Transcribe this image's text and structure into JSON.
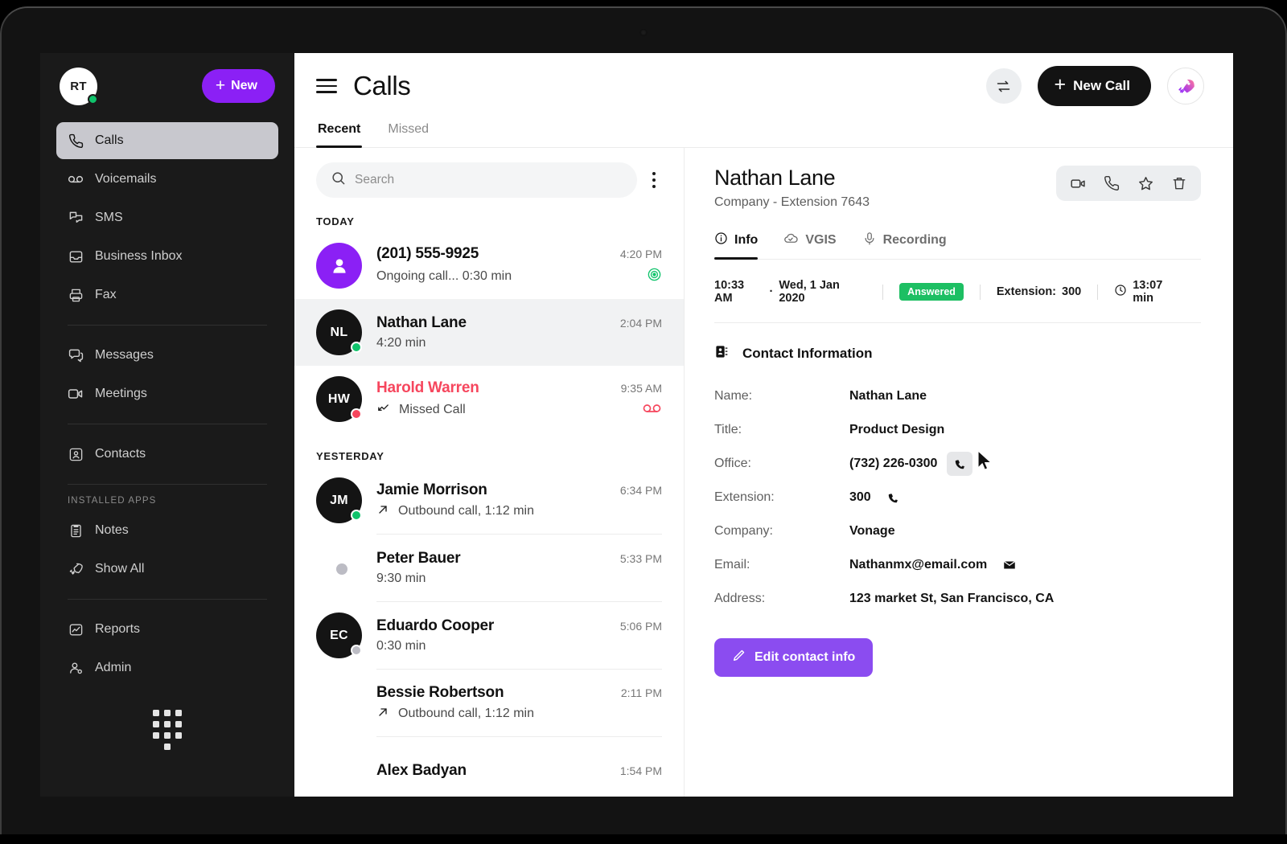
{
  "sidebar": {
    "avatar_initials": "RT",
    "new_button": "New",
    "section_label": "INSTALLED APPS",
    "items": [
      {
        "label": "Calls",
        "icon": "phone-icon"
      },
      {
        "label": "Voicemails",
        "icon": "voicemail-icon"
      },
      {
        "label": "SMS",
        "icon": "sms-icon"
      },
      {
        "label": "Business Inbox",
        "icon": "inbox-icon"
      },
      {
        "label": "Fax",
        "icon": "fax-icon"
      },
      {
        "label": "Messages",
        "icon": "messages-icon"
      },
      {
        "label": "Meetings",
        "icon": "video-icon"
      },
      {
        "label": "Contacts",
        "icon": "contacts-icon"
      },
      {
        "label": "Notes",
        "icon": "notes-icon"
      },
      {
        "label": "Show All",
        "icon": "rocket-icon"
      },
      {
        "label": "Reports",
        "icon": "reports-icon"
      },
      {
        "label": "Admin",
        "icon": "admin-icon"
      }
    ]
  },
  "header": {
    "title": "Calls",
    "new_call": "New Call",
    "tabs": [
      {
        "label": "Recent"
      },
      {
        "label": "Missed"
      }
    ]
  },
  "search": {
    "placeholder": "Search",
    "value": ""
  },
  "call_list": {
    "groups": [
      {
        "day": "TODAY",
        "calls": [
          {
            "name": "(201) 555-9925",
            "initials": "",
            "time": "4:20 PM",
            "subtitle": "Ongoing call... 0:30 min",
            "status": "ongoing"
          },
          {
            "name": "Nathan Lane",
            "initials": "NL",
            "time": "2:04 PM",
            "subtitle": "4:20 min",
            "status": "answered"
          },
          {
            "name": "Harold Warren",
            "initials": "HW",
            "time": "9:35 AM",
            "subtitle": "Missed Call",
            "status": "missed"
          }
        ]
      },
      {
        "day": "YESTERDAY",
        "calls": [
          {
            "name": "Jamie Morrison",
            "initials": "JM",
            "time": "6:34 PM",
            "subtitle": "Outbound call, 1:12 min",
            "status": "outbound"
          },
          {
            "name": "Peter Bauer",
            "initials": "",
            "time": "5:33 PM",
            "subtitle": "9:30 min",
            "status": "plain"
          },
          {
            "name": "Eduardo Cooper",
            "initials": "EC",
            "time": "5:06 PM",
            "subtitle": "0:30 min",
            "status": "idle"
          },
          {
            "name": "Bessie Robertson",
            "initials": "",
            "time": "2:11 PM",
            "subtitle": "Outbound call, 1:12 min",
            "status": "outbound-noavatar"
          },
          {
            "name": "Alex Badyan",
            "initials": "",
            "time": "1:54 PM",
            "subtitle": "",
            "status": "plain"
          }
        ]
      }
    ]
  },
  "detail": {
    "name": "Nathan Lane",
    "subtitle": "Company -  Extension 7643",
    "tabs": [
      {
        "label": "Info",
        "icon": "info-icon"
      },
      {
        "label": "VGIS",
        "icon": "cloud-check-icon"
      },
      {
        "label": "Recording",
        "icon": "microphone-icon"
      }
    ],
    "meta": {
      "time": "10:33 AM",
      "separator": "·",
      "date": "Wed, 1 Jan 2020",
      "status_badge": "Answered",
      "extension_label": "Extension:",
      "extension_value": "300",
      "duration": "13:07 min"
    },
    "contact_info_title": "Contact Information",
    "fields": [
      {
        "key": "Name:",
        "value": "Nathan Lane",
        "action": ""
      },
      {
        "key": "Title:",
        "value": "Product  Design",
        "action": ""
      },
      {
        "key": "Office:",
        "value": "(732) 226-0300",
        "action": "call-icon-hover"
      },
      {
        "key": "Extension:",
        "value": "300",
        "action": "call-icon"
      },
      {
        "key": "Company:",
        "value": "Vonage",
        "action": ""
      },
      {
        "key": "Email:",
        "value": "Nathanmx@email.com",
        "action": "mail-icon"
      },
      {
        "key": "Address:",
        "value": "123 market St, San Francisco, CA",
        "action": ""
      }
    ],
    "edit_button": "Edit contact info"
  },
  "colors": {
    "brand_purple": "#8b20f5",
    "edit_purple": "#8b4cf0",
    "green": "#0fc36b",
    "badge_green": "#1dbf63",
    "red": "#f6465d",
    "sidebar_bg": "#1a1a1a",
    "dark": "#131313"
  }
}
